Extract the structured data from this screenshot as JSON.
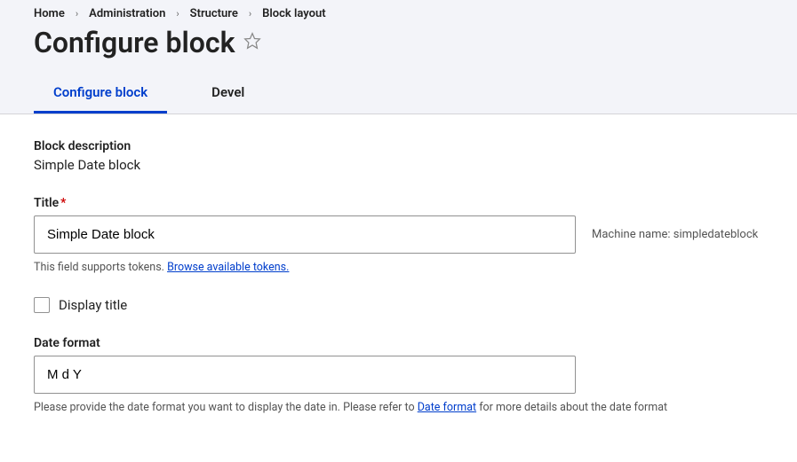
{
  "breadcrumb": {
    "items": [
      "Home",
      "Administration",
      "Structure",
      "Block layout"
    ]
  },
  "page": {
    "title": "Configure block"
  },
  "tabs": {
    "configure": "Configure block",
    "devel": "Devel"
  },
  "block_description": {
    "label": "Block description",
    "value": "Simple Date block"
  },
  "title_field": {
    "label": "Title",
    "value": "Simple Date block",
    "machine_label": "Machine name:",
    "machine_value": "simpledateblock",
    "help_text": "This field supports tokens.",
    "help_link": "Browse available tokens."
  },
  "display_title": {
    "label": "Display title"
  },
  "date_format": {
    "label": "Date format",
    "value": "M d Y",
    "help_before": "Please provide the date format you want to display the date in. Please refer to ",
    "help_link": "Date format",
    "help_after": " for more details about the date format"
  }
}
